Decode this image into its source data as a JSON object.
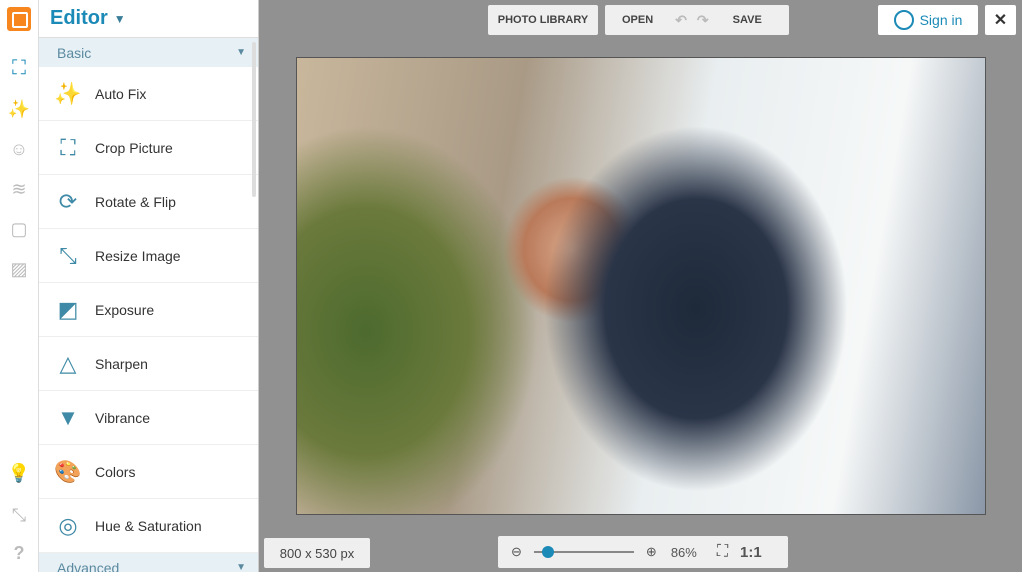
{
  "header": {
    "title": "Editor",
    "photo_library": "PHOTO LIBRARY",
    "open": "OPEN",
    "save": "SAVE",
    "sign_in": "Sign in",
    "close": "✕"
  },
  "panel": {
    "basic": "Basic",
    "advanced": "Advanced",
    "items": [
      {
        "label": "Auto Fix",
        "icon": "✨"
      },
      {
        "label": "Crop Picture",
        "icon": "⛶"
      },
      {
        "label": "Rotate & Flip",
        "icon": "⟳"
      },
      {
        "label": "Resize Image",
        "icon": "⤡"
      },
      {
        "label": "Exposure",
        "icon": "◩"
      },
      {
        "label": "Sharpen",
        "icon": "△"
      },
      {
        "label": "Vibrance",
        "icon": "▼"
      },
      {
        "label": "Colors",
        "icon": "🎨"
      },
      {
        "label": "Hue & Saturation",
        "icon": "◎"
      }
    ]
  },
  "footer": {
    "dimensions": "800 x 530 px",
    "zoom": "86%",
    "one_to_one": "1:1",
    "zoom_fraction": 0.14
  },
  "colors": {
    "accent": "#1b8ab7",
    "logo": "#f7861f"
  }
}
